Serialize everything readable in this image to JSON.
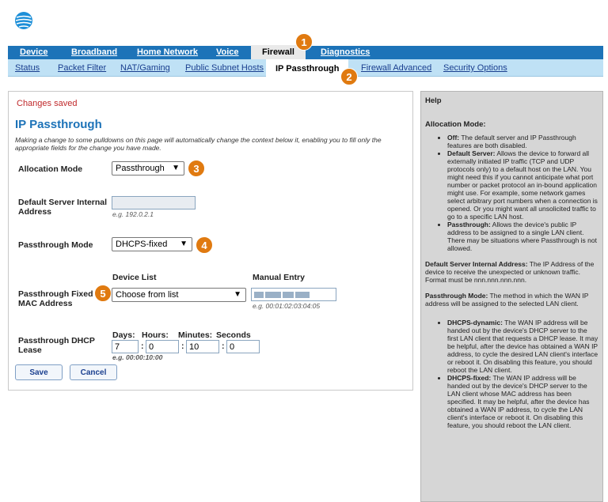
{
  "brand": {
    "logo_icon": "att-globe-icon"
  },
  "top_nav": [
    {
      "label": "Device",
      "active": false
    },
    {
      "label": "Broadband",
      "active": false
    },
    {
      "label": "Home Network",
      "active": false
    },
    {
      "label": "Voice",
      "active": false
    },
    {
      "label": "Firewall",
      "active": true
    },
    {
      "label": "Diagnostics",
      "active": false
    }
  ],
  "sub_nav": [
    {
      "label": "Status"
    },
    {
      "label": "Packet Filter"
    },
    {
      "label": "NAT/Gaming"
    },
    {
      "label": "Public Subnet Hosts"
    },
    {
      "label": "IP Passthrough",
      "active": true
    },
    {
      "label": "Firewall Advanced"
    },
    {
      "label": "Security Options"
    }
  ],
  "badges": [
    "1",
    "2",
    "3",
    "4",
    "5"
  ],
  "main": {
    "status": "Changes saved",
    "title": "IP Passthrough",
    "note": "Making a change to some pulldowns on this page will automatically change the context below it, enabling you to fill only the appropriate fields for the change you have made.",
    "allocation_mode": {
      "label": "Allocation Mode",
      "value": "Passthrough"
    },
    "default_server": {
      "label": "Default Server Internal Address",
      "value": "",
      "example": "e.g. 192.0.2.1"
    },
    "passthrough_mode": {
      "label": "Passthrough Mode",
      "value": "DHCPS-fixed"
    },
    "mac": {
      "label": "Passthrough Fixed MAC Address",
      "device_list_header": "Device List",
      "manual_entry_header": "Manual Entry",
      "device_list_value": "Choose from list",
      "manual_example": "e.g. 00:01:02:03:04:05"
    },
    "lease": {
      "label": "Passthrough DHCP Lease",
      "days_label": "Days:",
      "hours_label": "Hours:",
      "minutes_label": "Minutes:",
      "seconds_label": "Seconds",
      "days": "7",
      "hours": "0",
      "minutes": "10",
      "seconds": "0",
      "example": "e.g. 00:00:10:00",
      "sep": ":"
    },
    "save_label": "Save",
    "cancel_label": "Cancel"
  },
  "help": {
    "title": "Help",
    "allocation_heading": "Allocation Mode:",
    "alloc_items": [
      {
        "term": "Off:",
        "text": " The default server and IP Passthrough features are both disabled."
      },
      {
        "term": "Default Server:",
        "text": " Allows the device to forward all externally initiated IP traffic (TCP and UDP protocols only) to a default host on the LAN. You might need this if you cannot anticipate what port number or packet protocol an in-bound application might use. For example, some network games select arbitrary port numbers when a connection is opened. Or you might want all unsolicited traffic to go to a specific LAN host."
      },
      {
        "term": "Passthrough:",
        "text": " Allows the device's public IP address to be assigned to a single LAN client. There may be situations where Passthrough is not allowed."
      }
    ],
    "default_server_term": "Default Server Internal Address:",
    "default_server_text": " The IP Address of the device to receive the unexpected or unknown traffic. Format must be nnn.nnn.nnn.nnn.",
    "passthrough_mode_term": "Passthrough Mode:",
    "passthrough_mode_text": " The method in which the WAN IP address will be assigned to the selected LAN client.",
    "mode_items": [
      {
        "term": "DHCPS-dynamic:",
        "text": " The WAN IP address will be handed out by the device's DHCP server to the first LAN client that requests a DHCP lease. It may be helpful, after the device has obtained a WAN IP address, to cycle the desired LAN client's interface or reboot it. On disabling this feature, you should reboot the LAN client."
      },
      {
        "term": "DHCPS-fixed:",
        "text": " The WAN IP address will be handed out by the device's DHCP server to the LAN client whose MAC address has been specified. It may be helpful, after the device has obtained a WAN IP address, to cycle the LAN client's interface or reboot it. On disabling this feature, you should reboot the LAN client."
      }
    ]
  }
}
